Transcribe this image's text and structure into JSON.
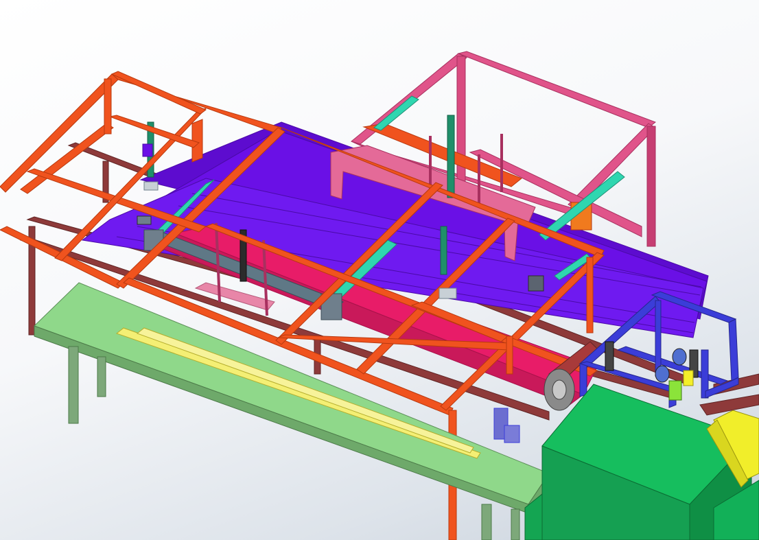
{
  "viewport": {
    "background_top": "#ffffff",
    "background_bottom": "#c9d1db"
  },
  "colors": {
    "orange_frame": "#f0531e",
    "orange_frame_dark": "#b8390f",
    "pink_frame": "#e0548a",
    "pink_frame_dark": "#a8305f",
    "violet_sheets": "#6a10e6",
    "violet_edge": "#4a0aa6",
    "magenta_panel": "#e81c68",
    "rail_brown": "#8e3a3a",
    "rail_dark": "#5f2424",
    "green_conveyor": "#8fd88a",
    "green_conveyor_side": "#6ea96a",
    "yellow_rods": "#f4ef74",
    "teal_cylinder": "#2fd6b0",
    "teal_cylinder_dark": "#1f8f76",
    "blue_frame": "#3b3dd8",
    "green_box_top": "#16be5e",
    "green_box_front": "#0f9b49",
    "yellow_block": "#f1ee2a",
    "steel_gray": "#6f7f8c",
    "dark_rod": "#2b2b2b"
  }
}
